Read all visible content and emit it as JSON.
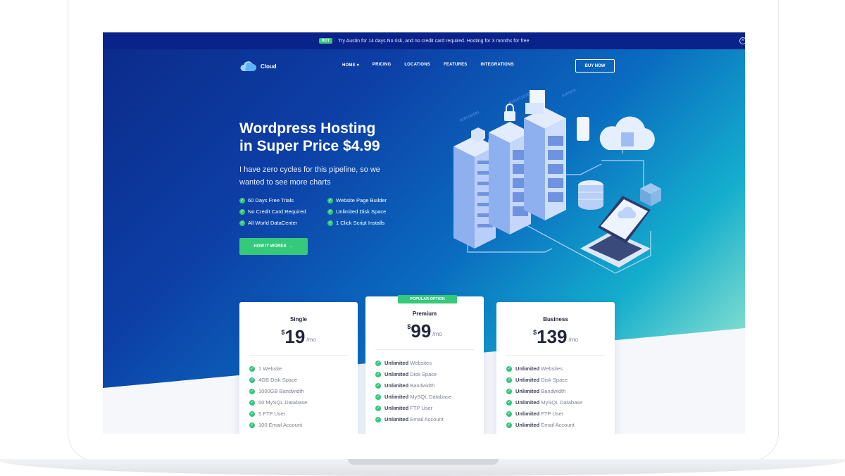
{
  "announcement": {
    "badge": "HOT",
    "text": "Try Austin for 14 days.No risk, and no credit card required. Hosting for 3 months for free",
    "close_icon": "close-icon"
  },
  "logo": {
    "text": "Cloud",
    "icon": "cloud-icon"
  },
  "nav": {
    "items": [
      "HOME",
      "PRICING",
      "LOCATIONS",
      "FEATURES",
      "INTEGRATIONS"
    ],
    "home_dropdown_icon": "chevron-down-icon",
    "buy_label": "BUY NOW"
  },
  "hero": {
    "title_line1": "Wordpress Hosting",
    "title_line2": "in Super Price $4.99",
    "subtitle": "I have zero cycles for this pipeline, so we wanted to see more charts",
    "features": [
      "60 Days Free Trials",
      "Website Page Builder",
      "No Credit Card Required",
      "Unlimited Disk Space",
      "All World DataCenter",
      "1 Click Script Installs"
    ],
    "cta_label": "HOW IT WORKS",
    "cta_icon": "arrow-right-icon"
  },
  "pricing": {
    "popular_label": "POPULAR OPTION",
    "plans": [
      {
        "name": "Single",
        "currency": "$",
        "price": "19",
        "period": "/mo",
        "features": [
          {
            "bold": "",
            "text": "1 Website"
          },
          {
            "bold": "",
            "text": "4GB Disk Space"
          },
          {
            "bold": "",
            "text": "1000GB Bandwidth"
          },
          {
            "bold": "",
            "text": "50 MySQL Database"
          },
          {
            "bold": "",
            "text": "5 FTP User"
          },
          {
            "bold": "",
            "text": "100 Email Account"
          }
        ]
      },
      {
        "name": "Premium",
        "currency": "$",
        "price": "99",
        "period": "/mo",
        "features": [
          {
            "bold": "Unlimited",
            "text": " Websites"
          },
          {
            "bold": "Unlimited",
            "text": " Disk Space"
          },
          {
            "bold": "Unlimited",
            "text": " Bandwidth"
          },
          {
            "bold": "Unlimited",
            "text": " MySQL Database"
          },
          {
            "bold": "Unlimited",
            "text": " FTP User"
          },
          {
            "bold": "Unlimited",
            "text": " Email Account"
          }
        ]
      },
      {
        "name": "Business",
        "currency": "$",
        "price": "139",
        "period": "/mo",
        "features": [
          {
            "bold": "Unlimited",
            "text": " Websites"
          },
          {
            "bold": "Unlimited",
            "text": " Disk Space"
          },
          {
            "bold": "Unlimited",
            "text": " Bandwidth"
          },
          {
            "bold": "Unlimited",
            "text": " MySQL Database"
          },
          {
            "bold": "Unlimited",
            "text": " FTP User"
          },
          {
            "bold": "Unlimited",
            "text": " Email Account"
          }
        ]
      }
    ]
  },
  "colors": {
    "accent_green": "#35c97a",
    "hero_blue": "#0d3fa6",
    "hero_teal": "#14aecd",
    "topbar": "#0a238a"
  }
}
